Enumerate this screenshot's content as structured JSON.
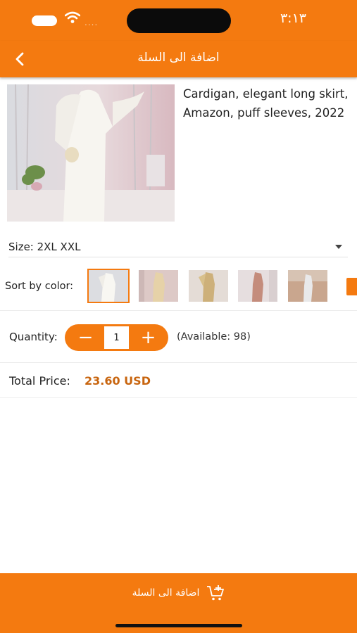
{
  "status_bar": {
    "time": "٣:١٣",
    "signal": "...."
  },
  "nav": {
    "title": "اضافة الى السلة",
    "back_icon": "chevron-left-icon"
  },
  "product": {
    "title": "Cardigan, elegant long skirt, Amazon, puff sleeves, 2022",
    "image_icon": "product-photo"
  },
  "size": {
    "label": "Size: 2XL XXL",
    "dropdown_icon": "caret-down-icon"
  },
  "color": {
    "label": "Sort by color:",
    "swatches": [
      {
        "name": "white",
        "selected": true
      },
      {
        "name": "beige",
        "selected": false
      },
      {
        "name": "gold",
        "selected": false
      },
      {
        "name": "rose",
        "selected": false
      },
      {
        "name": "grey",
        "selected": false
      }
    ]
  },
  "quantity": {
    "label": "Quantity:",
    "value": "1",
    "minus": "−",
    "plus": "+",
    "available": "(Available: 98)"
  },
  "total": {
    "label": "Total Price:",
    "value": "23.60 USD"
  },
  "bottom": {
    "add_to_cart": "اضافة الى السلة",
    "cart_icon": "cart-plus-icon"
  },
  "colors": {
    "accent": "#f47a10",
    "price": "#c8650f"
  }
}
